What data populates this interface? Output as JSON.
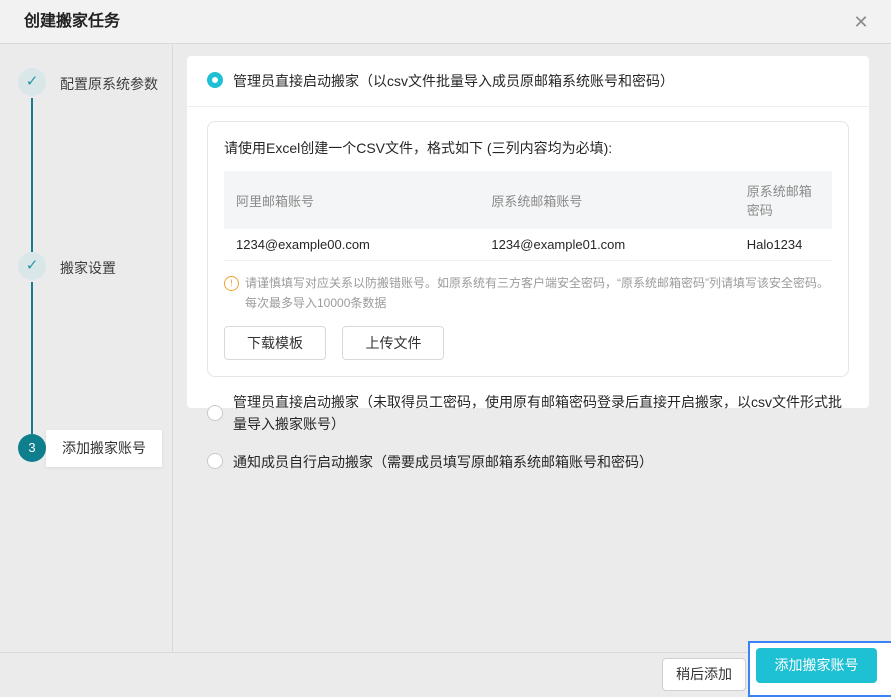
{
  "dialog": {
    "title": "创建搬家任务"
  },
  "icons": {
    "close": "✕",
    "check": "✓",
    "warning": "!"
  },
  "stepper": {
    "steps": [
      {
        "label": "配置原系统参数",
        "state": "done"
      },
      {
        "label": "搬家设置",
        "state": "done"
      },
      {
        "label": "添加搬家账号",
        "state": "current",
        "number": "3"
      }
    ]
  },
  "options": [
    {
      "label": "管理员直接启动搬家（以csv文件批量导入成员原邮箱系统账号和密码）",
      "selected": true
    },
    {
      "label": "管理员直接启动搬家（未取得员工密码，使用原有邮箱密码登录后直接开启搬家，以csv文件形式批量导入搬家账号）",
      "selected": false
    },
    {
      "label": "通知成员自行启动搬家（需要成员填写原邮箱系统邮箱账号和密码）",
      "selected": false
    }
  ],
  "csv_panel": {
    "instruction": "请使用Excel创建一个CSV文件，格式如下 (三列内容均为必填):",
    "table": {
      "headers": [
        "阿里邮箱账号",
        "原系统邮箱账号",
        "原系统邮箱密码"
      ],
      "rows": [
        [
          "1234@example00.com",
          "1234@example01.com",
          "Halo1234"
        ]
      ]
    },
    "note": "请谨慎填写对应关系以防搬错账号。如原系统有三方客户端安全密码，“原系统邮箱密码”列请填写该安全密码。每次最多导入10000条数据",
    "download_button": "下载模板",
    "upload_button": "上传文件"
  },
  "footer": {
    "later_button": "稍后添加",
    "primary_button": "添加搬家账号"
  },
  "colors": {
    "accent_cyan": "#1ec0d4",
    "stepper_teal": "#0f7f8d",
    "warning_orange": "#f0a32f",
    "highlight_border_blue": "#3b82f6"
  }
}
